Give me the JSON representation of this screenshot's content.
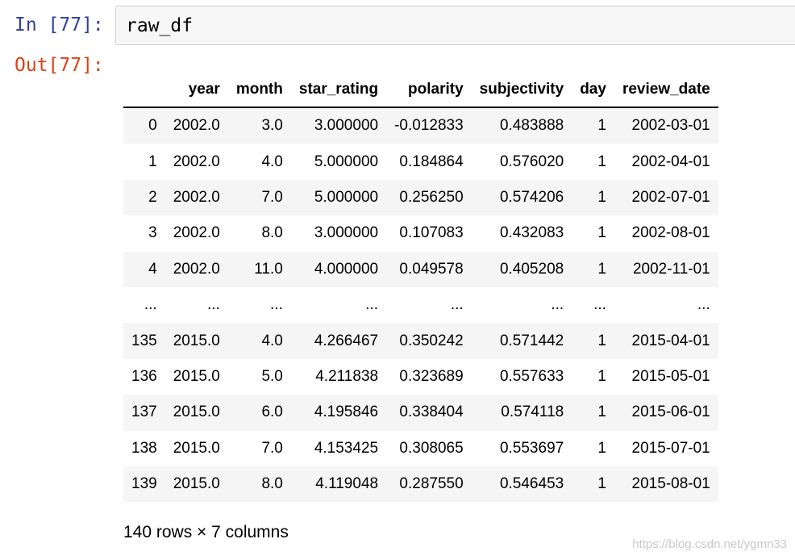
{
  "input": {
    "prompt": "In [77]:",
    "code": "raw_df"
  },
  "output": {
    "prompt": "Out[77]:",
    "columns": [
      "",
      "year",
      "month",
      "star_rating",
      "polarity",
      "subjectivity",
      "day",
      "review_date"
    ],
    "rows": [
      [
        "0",
        "2002.0",
        "3.0",
        "3.000000",
        "-0.012833",
        "0.483888",
        "1",
        "2002-03-01"
      ],
      [
        "1",
        "2002.0",
        "4.0",
        "5.000000",
        "0.184864",
        "0.576020",
        "1",
        "2002-04-01"
      ],
      [
        "2",
        "2002.0",
        "7.0",
        "5.000000",
        "0.256250",
        "0.574206",
        "1",
        "2002-07-01"
      ],
      [
        "3",
        "2002.0",
        "8.0",
        "3.000000",
        "0.107083",
        "0.432083",
        "1",
        "2002-08-01"
      ],
      [
        "4",
        "2002.0",
        "11.0",
        "4.000000",
        "0.049578",
        "0.405208",
        "1",
        "2002-11-01"
      ],
      [
        "...",
        "...",
        "...",
        "...",
        "...",
        "...",
        "...",
        "..."
      ],
      [
        "135",
        "2015.0",
        "4.0",
        "4.266467",
        "0.350242",
        "0.571442",
        "1",
        "2015-04-01"
      ],
      [
        "136",
        "2015.0",
        "5.0",
        "4.211838",
        "0.323689",
        "0.557633",
        "1",
        "2015-05-01"
      ],
      [
        "137",
        "2015.0",
        "6.0",
        "4.195846",
        "0.338404",
        "0.574118",
        "1",
        "2015-06-01"
      ],
      [
        "138",
        "2015.0",
        "7.0",
        "4.153425",
        "0.308065",
        "0.553697",
        "1",
        "2015-07-01"
      ],
      [
        "139",
        "2015.0",
        "8.0",
        "4.119048",
        "0.287550",
        "0.546453",
        "1",
        "2015-08-01"
      ]
    ],
    "shape_text": "140 rows × 7 columns"
  },
  "watermark": "https://blog.csdn.net/ygmn33",
  "colors": {
    "in_prompt": "#303f9f",
    "out_prompt": "#d84315",
    "cell_background": "#f7f7f7",
    "row_stripe": "#f5f5f5"
  }
}
